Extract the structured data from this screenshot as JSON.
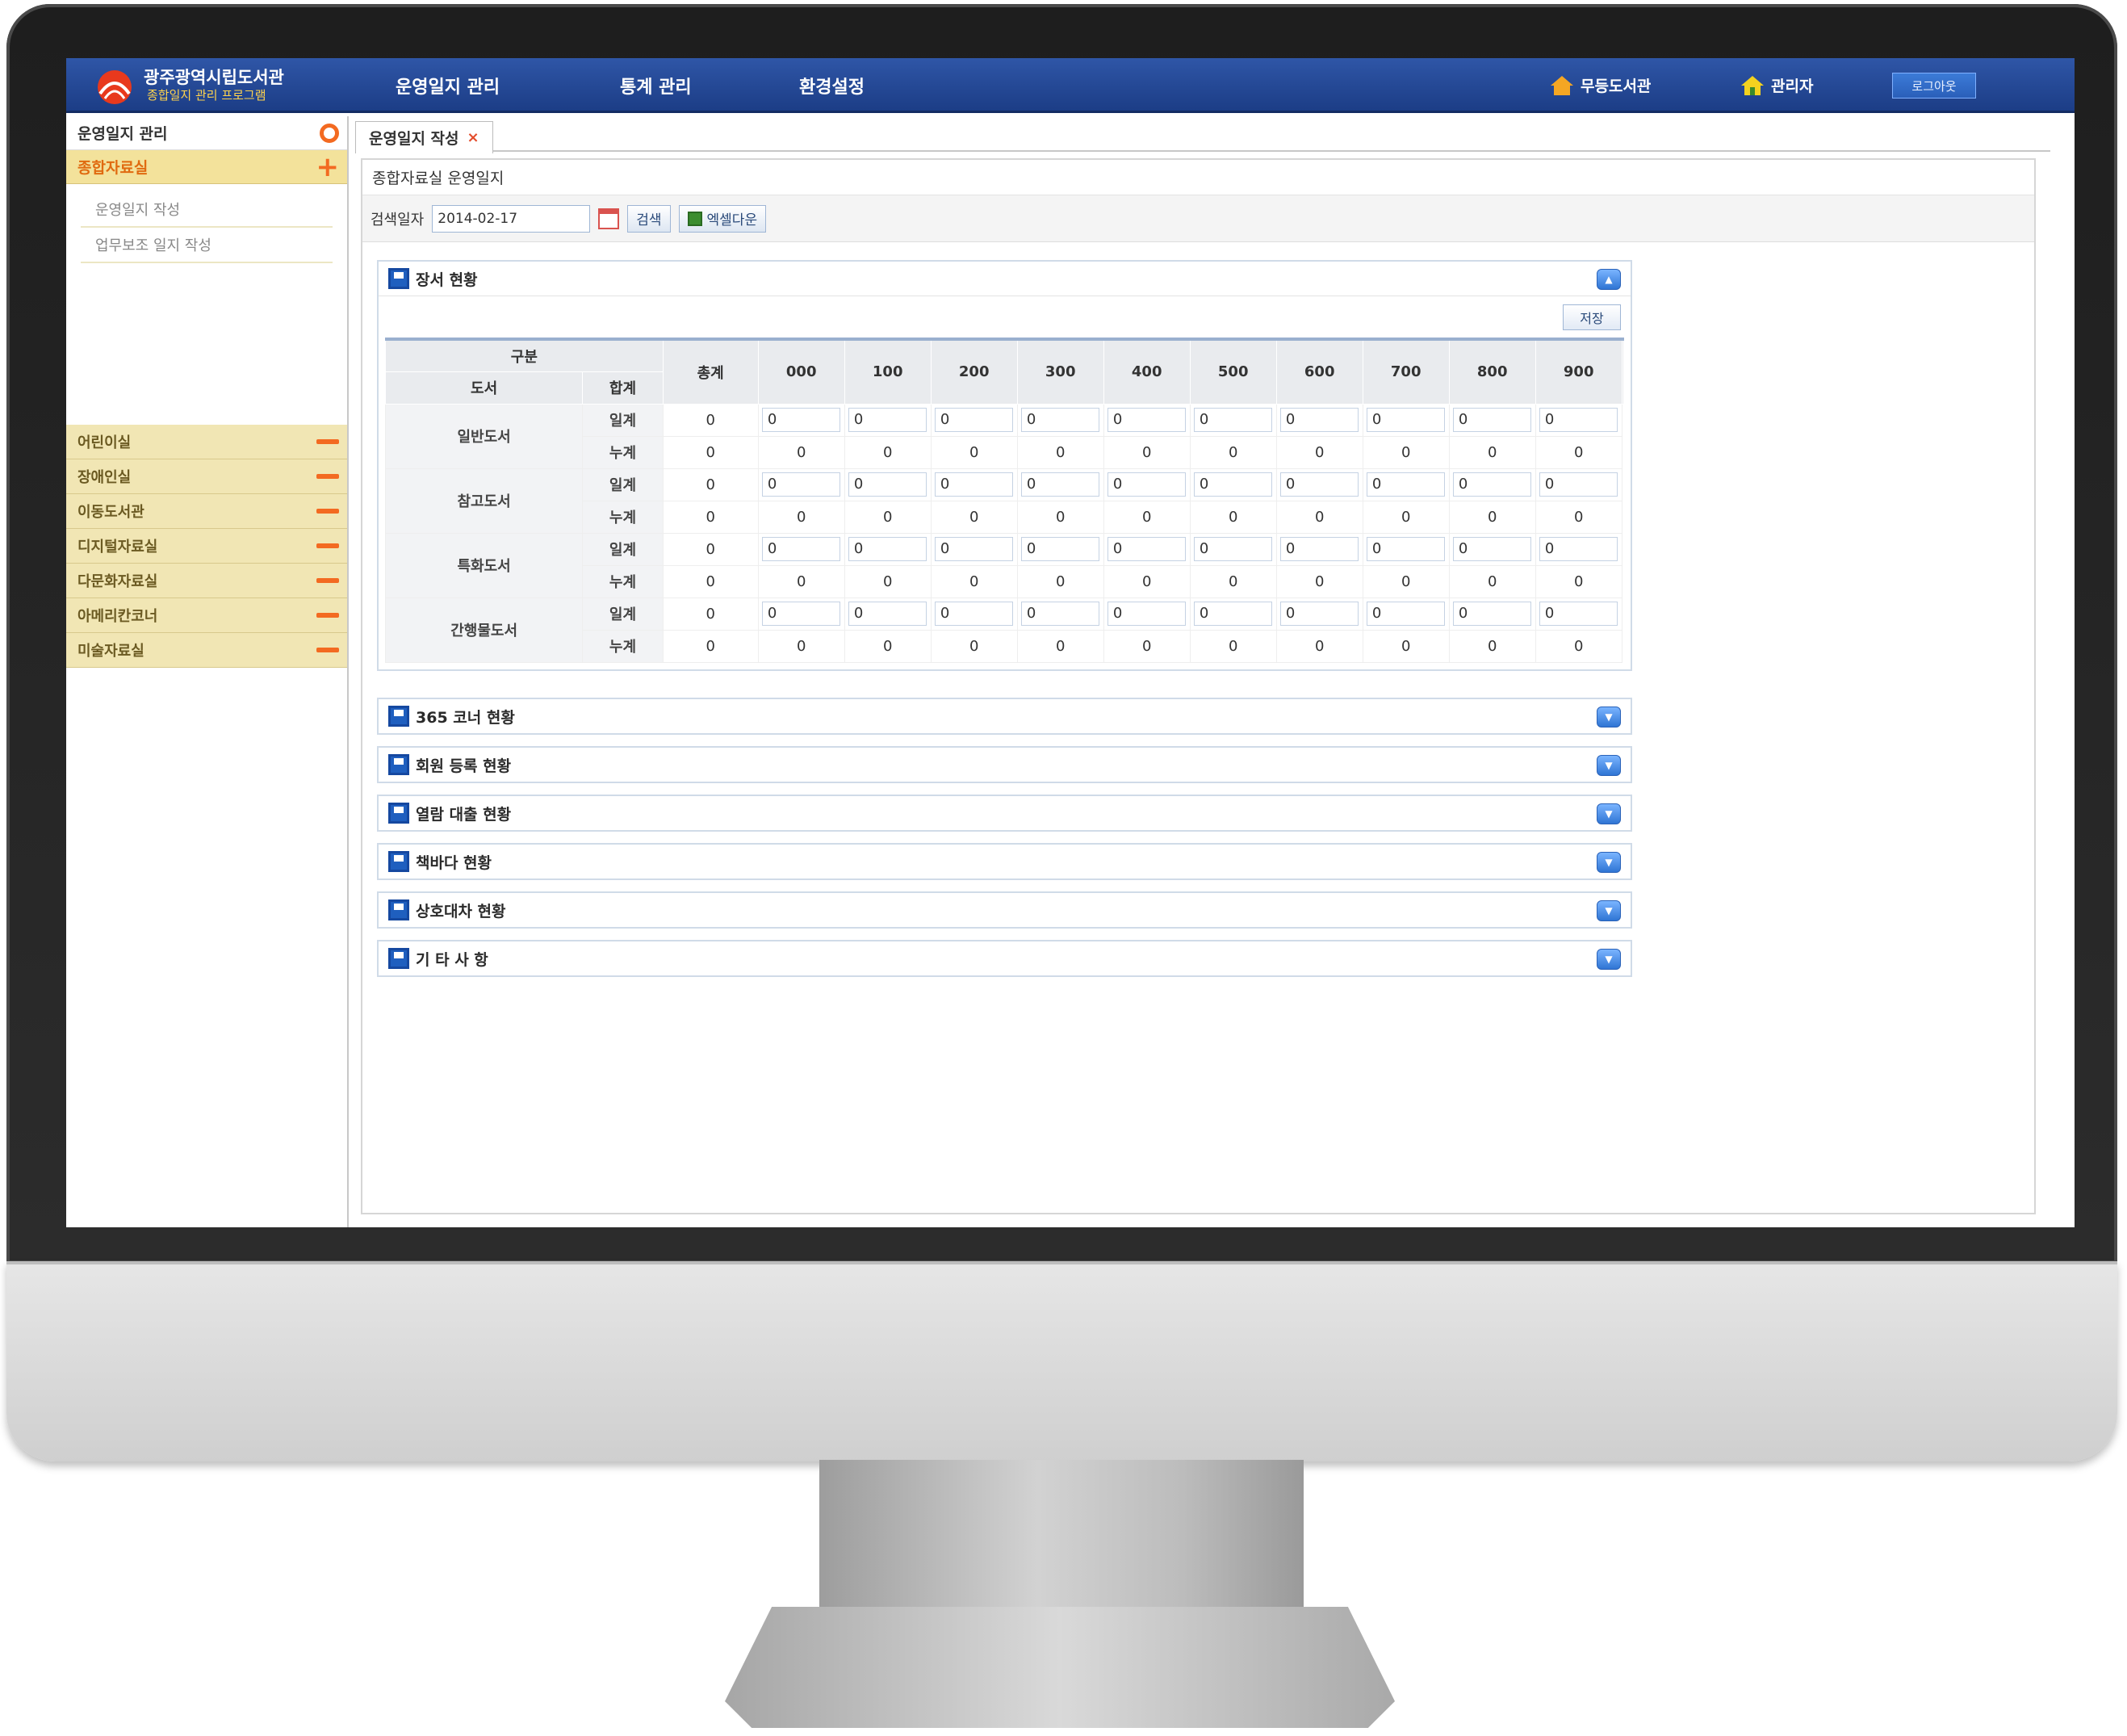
{
  "header": {
    "library_name": "광주광역시립도서관",
    "program_name": "종합일지 관리 프로그램",
    "nav": [
      "운영일지 관리",
      "통계 관리",
      "환경설정"
    ],
    "library_link": "무등도서관",
    "user_link": "관리자",
    "logout": "로그아웃"
  },
  "sidebar": {
    "title": "운영일지 관리",
    "active_group": "종합자료실",
    "sub_items": [
      "운영일지 작성",
      "업무보조 일지 작성"
    ],
    "groups": [
      "어린이실",
      "장애인실",
      "이동도서관",
      "디지털자료실",
      "다문화자료실",
      "아메리칸코너",
      "미술자료실"
    ]
  },
  "tab": {
    "label": "운영일지 작성",
    "close": "×"
  },
  "panel": {
    "title": "종합자료실 운영일지",
    "search_label": "검색일자",
    "date_value": "2014-02-17",
    "search_button": "검색",
    "excel_button": "엑셀다운"
  },
  "book_section": {
    "title": "장서 현황",
    "save_button": "저장",
    "header_group": "구분",
    "header_book": "도서",
    "header_sum": "합계",
    "header_total": "총계",
    "columns": [
      "000",
      "100",
      "200",
      "300",
      "400",
      "500",
      "600",
      "700",
      "800",
      "900"
    ],
    "categories": [
      {
        "name": "일반도서",
        "daily_label": "일계",
        "cumul_label": "누계",
        "daily_total": "0",
        "cumul_total": "0",
        "daily": [
          "0",
          "0",
          "0",
          "0",
          "0",
          "0",
          "0",
          "0",
          "0",
          "0"
        ],
        "cumul": [
          "0",
          "0",
          "0",
          "0",
          "0",
          "0",
          "0",
          "0",
          "0",
          "0"
        ]
      },
      {
        "name": "참고도서",
        "daily_label": "일계",
        "cumul_label": "누계",
        "daily_total": "0",
        "cumul_total": "0",
        "daily": [
          "0",
          "0",
          "0",
          "0",
          "0",
          "0",
          "0",
          "0",
          "0",
          "0"
        ],
        "cumul": [
          "0",
          "0",
          "0",
          "0",
          "0",
          "0",
          "0",
          "0",
          "0",
          "0"
        ]
      },
      {
        "name": "특화도서",
        "daily_label": "일계",
        "cumul_label": "누계",
        "daily_total": "0",
        "cumul_total": "0",
        "daily": [
          "0",
          "0",
          "0",
          "0",
          "0",
          "0",
          "0",
          "0",
          "0",
          "0"
        ],
        "cumul": [
          "0",
          "0",
          "0",
          "0",
          "0",
          "0",
          "0",
          "0",
          "0",
          "0"
        ]
      },
      {
        "name": "간행물도서",
        "daily_label": "일계",
        "cumul_label": "누계",
        "daily_total": "0",
        "cumul_total": "0",
        "daily": [
          "0",
          "0",
          "0",
          "0",
          "0",
          "0",
          "0",
          "0",
          "0",
          "0"
        ],
        "cumul": [
          "0",
          "0",
          "0",
          "0",
          "0",
          "0",
          "0",
          "0",
          "0",
          "0"
        ]
      }
    ]
  },
  "collapsed_sections": [
    "365 코너 현황",
    "회원 등록 현황",
    "열람 대출 현황",
    "책바다 현황",
    "상호대차 현황",
    "기 타 사 항"
  ],
  "colors": {
    "header_blue": "#1f4594",
    "accent_orange": "#f36a21",
    "sidebar_yellow": "#f1e6b4"
  }
}
